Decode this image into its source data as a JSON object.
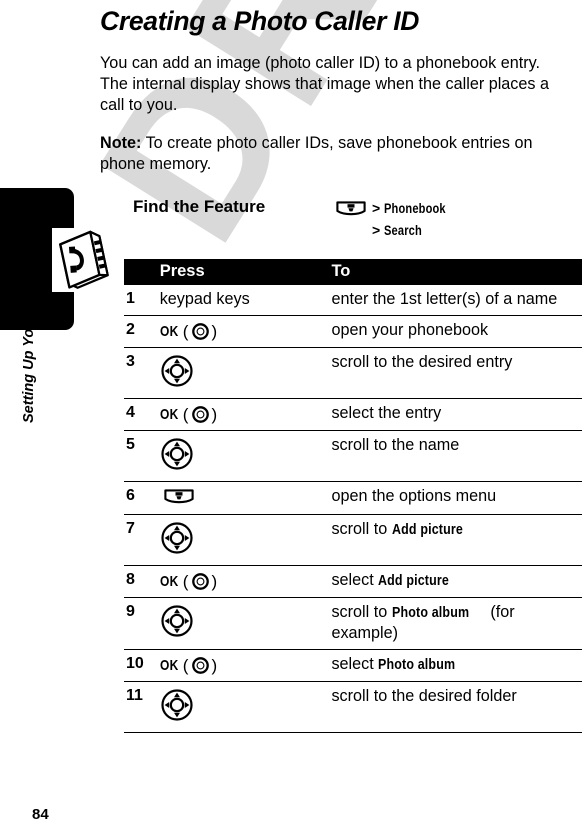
{
  "document": {
    "title": "Creating a Photo Caller ID",
    "watermark": "DRAFT",
    "page_number": "84",
    "running_head": "Setting Up Your Phonebook",
    "sidebar_icon": "phonebook-book-icon"
  },
  "paragraphs": {
    "intro": "You can add an image (photo caller ID) to a phonebook entry. The internal display shows that image when the caller places a call to you.",
    "note_label": "Note:",
    "note_text": " To create photo caller IDs, save phonebook entries on phone memory."
  },
  "find_the_feature": {
    "label": "Find the Feature",
    "menu_icon": "menu-softkey-icon",
    "lines": [
      {
        "separator": ">",
        "term": "Phonebook"
      },
      {
        "separator": ">",
        "term": "Search"
      }
    ]
  },
  "steps_table": {
    "headers": {
      "num": "",
      "press": "Press",
      "to": "To"
    },
    "rows": [
      {
        "num": "1",
        "press_type": "text",
        "press": "keypad keys",
        "to_prefix": "enter the 1st letter(s) of a name",
        "to_term": "",
        "to_suffix": ""
      },
      {
        "num": "2",
        "press_type": "ok",
        "press": "OK",
        "to_prefix": "open your phonebook",
        "to_term": "",
        "to_suffix": ""
      },
      {
        "num": "3",
        "press_type": "dpad",
        "press": "",
        "to_prefix": "scroll to the desired entry",
        "to_term": "",
        "to_suffix": ""
      },
      {
        "num": "4",
        "press_type": "ok",
        "press": "OK",
        "to_prefix": "select the entry",
        "to_term": "",
        "to_suffix": ""
      },
      {
        "num": "5",
        "press_type": "dpad",
        "press": "",
        "to_prefix": "scroll to the name",
        "to_term": "",
        "to_suffix": ""
      },
      {
        "num": "6",
        "press_type": "menu",
        "press": "",
        "to_prefix": "open the options menu",
        "to_term": "",
        "to_suffix": ""
      },
      {
        "num": "7",
        "press_type": "dpad",
        "press": "",
        "to_prefix": "scroll to ",
        "to_term": "Add picture",
        "to_suffix": ""
      },
      {
        "num": "8",
        "press_type": "ok",
        "press": "OK",
        "to_prefix": "select ",
        "to_term": "Add picture",
        "to_suffix": ""
      },
      {
        "num": "9",
        "press_type": "dpad",
        "press": "",
        "to_prefix": "scroll to ",
        "to_term": "Photo album",
        "to_suffix": " (for example)"
      },
      {
        "num": "10",
        "press_type": "ok",
        "press": "OK",
        "to_prefix": "select ",
        "to_term": "Photo album",
        "to_suffix": ""
      },
      {
        "num": "11",
        "press_type": "dpad",
        "press": "",
        "to_prefix": "scroll to the desired folder",
        "to_term": "",
        "to_suffix": ""
      }
    ]
  },
  "colors": {
    "ink": "#000000",
    "paper": "#ffffff",
    "watermark": "#d9d9d9",
    "header_bar": "#000000"
  }
}
